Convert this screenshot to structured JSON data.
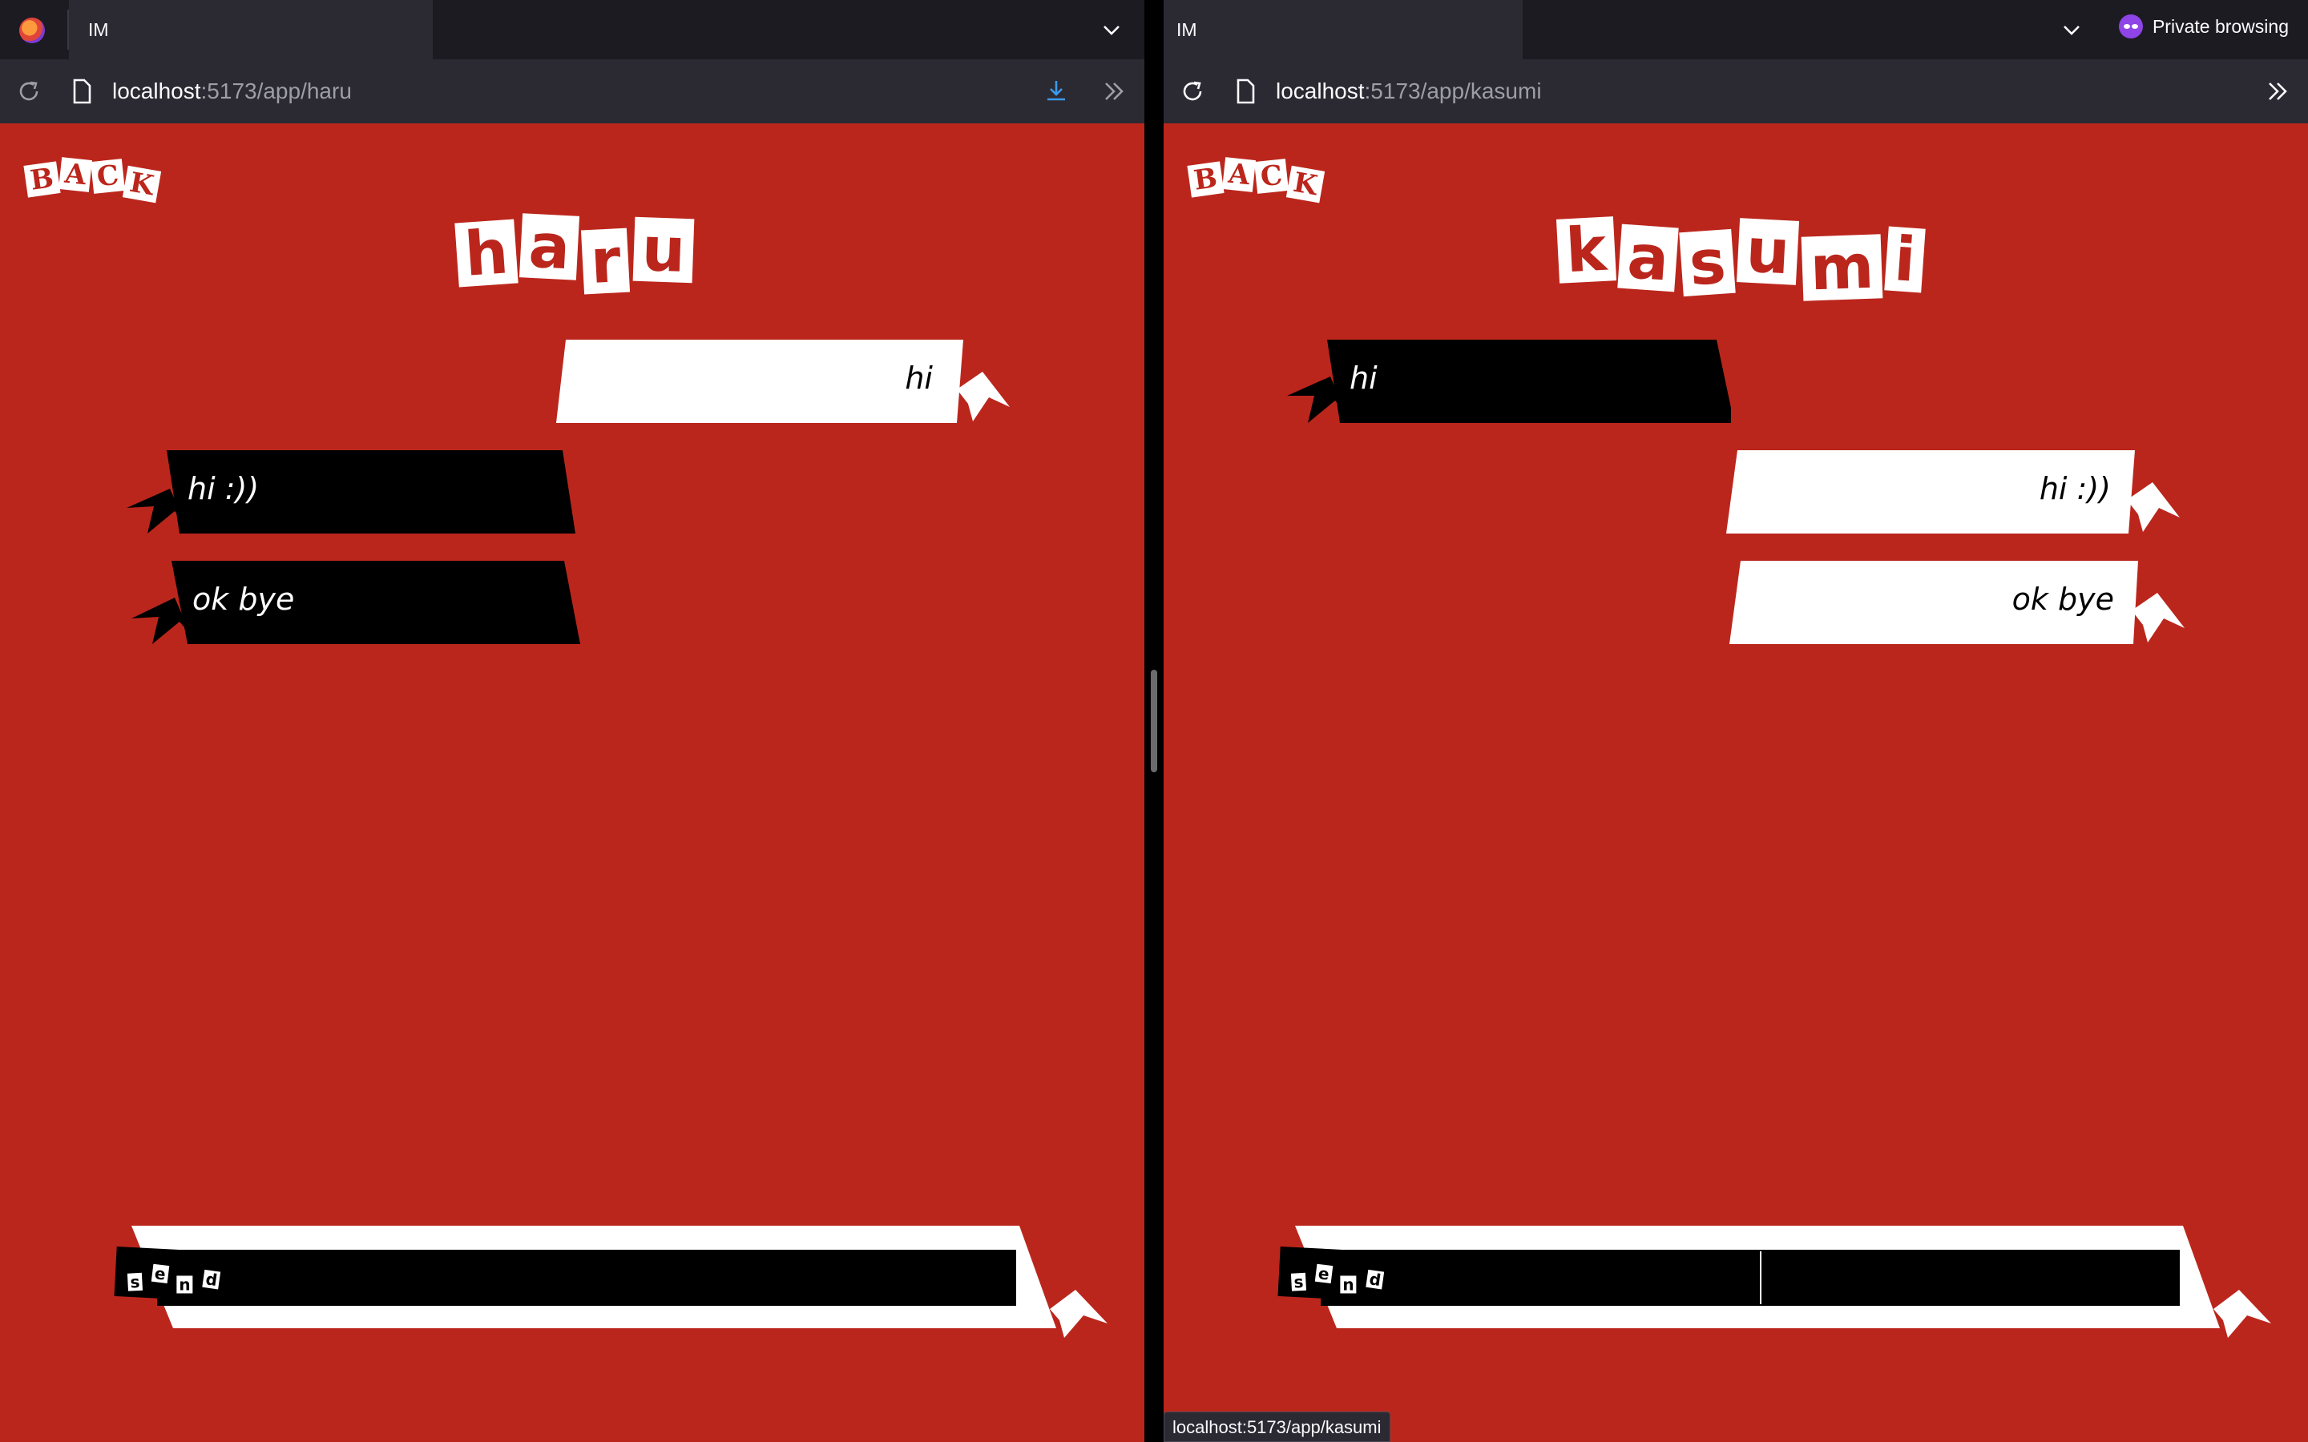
{
  "left": {
    "tab_title": "IM",
    "url_host": "localhost",
    "url_path": ":5173/app/haru",
    "back_letters": [
      "B",
      "A",
      "C",
      "K"
    ],
    "title_letters": [
      "h",
      "a",
      "r",
      "u"
    ],
    "messages": [
      {
        "text": "hi",
        "side": "sent"
      },
      {
        "text": "hi :))",
        "side": "received"
      },
      {
        "text": "ok bye",
        "side": "received"
      }
    ],
    "send_letters": [
      "s",
      "e",
      "n",
      "d"
    ],
    "input_value": ""
  },
  "right": {
    "tab_title": "IM",
    "private_label": "Private browsing",
    "url_host": "localhost",
    "url_path": ":5173/app/kasumi",
    "back_letters": [
      "B",
      "A",
      "C",
      "K"
    ],
    "title_letters": [
      "k",
      "a",
      "s",
      "u",
      "m",
      "i"
    ],
    "messages": [
      {
        "text": "hi",
        "side": "received"
      },
      {
        "text": "hi :))",
        "side": "sent"
      },
      {
        "text": "ok bye",
        "side": "sent"
      }
    ],
    "send_letters": [
      "s",
      "e",
      "n",
      "d"
    ],
    "input_value": ""
  },
  "status_url": "localhost:5173/app/kasumi",
  "icons": {
    "firefox": "firefox-logo-icon",
    "chevron": "chevron-down-icon",
    "reload": "reload-icon",
    "page": "page-icon",
    "download": "download-icon",
    "overflow": "overflow-chevrons-icon",
    "private": "private-browsing-mask-icon"
  },
  "colors": {
    "background_red": "#bb261c",
    "bubble_black": "#000000",
    "bubble_white": "#ffffff",
    "browser_chrome": "#2b2a33",
    "download_accent": "#3d9ae8"
  }
}
